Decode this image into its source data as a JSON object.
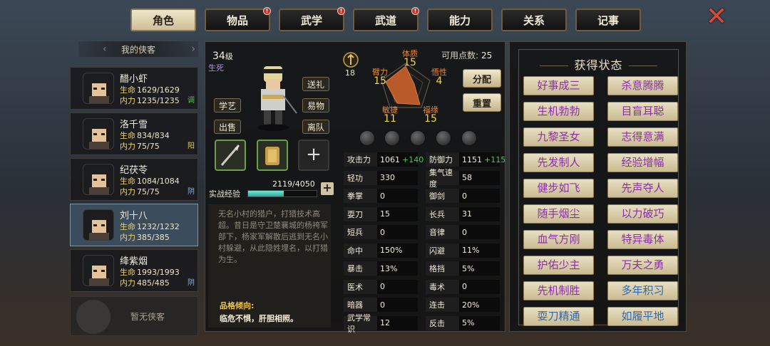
{
  "tabs": [
    {
      "label": "角色",
      "active": true,
      "badge": false
    },
    {
      "label": "物品",
      "active": false,
      "badge": true
    },
    {
      "label": "武学",
      "active": false,
      "badge": true
    },
    {
      "label": "武道",
      "active": false,
      "badge": true
    },
    {
      "label": "能力",
      "active": false,
      "badge": false
    },
    {
      "label": "关系",
      "active": false,
      "badge": false
    },
    {
      "label": "记事",
      "active": false,
      "badge": false
    }
  ],
  "close_glyph": "✕",
  "list": {
    "title": "我的侠客",
    "labels": {
      "hp": "生命",
      "mp": "内力"
    },
    "heroes": [
      {
        "name": "醋小虾",
        "hp": "1629/1629",
        "mp": "1235/1235",
        "tag": "调",
        "tag_color": "#58c35b",
        "active": false
      },
      {
        "name": "洛千雪",
        "hp": "834/834",
        "mp": "75/75",
        "tag": "阳",
        "tag_color": "#f1d04a",
        "active": false
      },
      {
        "name": "纪茯苓",
        "hp": "1084/1084",
        "mp": "75/75",
        "tag": "阴",
        "tag_color": "#8fb0d6",
        "active": false
      },
      {
        "name": "刘十八",
        "hp": "1232/1232",
        "mp": "385/385",
        "tag": "",
        "tag_color": "#ffffff",
        "active": true
      },
      {
        "name": "绛紫烟",
        "hp": "1993/1993",
        "mp": "485/485",
        "tag": "阴",
        "tag_color": "#8fb0d6",
        "active": false
      }
    ],
    "empty_label": "暂无侠客"
  },
  "character": {
    "level": "34",
    "level_suffix": "级",
    "state": "生死",
    "buttons": {
      "learn": "学艺",
      "sell": "出售",
      "gift": "送礼",
      "trade": "易物",
      "leave": "离队"
    },
    "exp_label": "实战经验",
    "exp_text": "2119/4050",
    "exp_progress": 0.523,
    "bio": "无名小村的猎户，打猎技术高超。昔日是守卫楚襄城的杨袴军部下，杨家军解散后逃到无名小村躲避，从此隐姓埋名，以打猎为生。",
    "trait_label": "品格倾向:",
    "trait": "临危不惧，肝胆相照。",
    "medal_count": "18"
  },
  "attributes": {
    "points_label": "可用点数:",
    "points": "25",
    "allocate": "分配",
    "reset": "重置",
    "items": [
      {
        "name": "体质",
        "value": "15"
      },
      {
        "name": "悟性",
        "value": "4"
      },
      {
        "name": "福缘",
        "value": "15"
      },
      {
        "name": "敏捷",
        "value": "11"
      },
      {
        "name": "臂力",
        "value": "15"
      }
    ]
  },
  "stats": [
    {
      "k": "攻击力",
      "v": "1061",
      "bonus": "+140"
    },
    {
      "k": "防御力",
      "v": "1151",
      "bonus": "+115"
    },
    {
      "k": "轻功",
      "v": "330",
      "bonus": ""
    },
    {
      "k": "集气速度",
      "v": "58",
      "bonus": ""
    },
    {
      "k": "拳掌",
      "v": "0",
      "bonus": ""
    },
    {
      "k": "御剑",
      "v": "0",
      "bonus": ""
    },
    {
      "k": "耍刀",
      "v": "15",
      "bonus": ""
    },
    {
      "k": "长兵",
      "v": "31",
      "bonus": ""
    },
    {
      "k": "短兵",
      "v": "0",
      "bonus": ""
    },
    {
      "k": "音律",
      "v": "0",
      "bonus": ""
    },
    {
      "k": "命中",
      "v": "150%",
      "bonus": ""
    },
    {
      "k": "闪避",
      "v": "11%",
      "bonus": ""
    },
    {
      "k": "暴击",
      "v": "13%",
      "bonus": ""
    },
    {
      "k": "格挡",
      "v": "5%",
      "bonus": ""
    },
    {
      "k": "医术",
      "v": "0",
      "bonus": ""
    },
    {
      "k": "毒术",
      "v": "0",
      "bonus": ""
    },
    {
      "k": "暗器",
      "v": "0",
      "bonus": ""
    },
    {
      "k": "连击",
      "v": "20%",
      "bonus": ""
    },
    {
      "k": "武学常识",
      "v": "12",
      "bonus": ""
    },
    {
      "k": "反击",
      "v": "5%",
      "bonus": ""
    }
  ],
  "status_panel": {
    "title": "获得状态",
    "items": [
      {
        "label": "好事成三",
        "color": "purple"
      },
      {
        "label": "杀意腾腾",
        "color": "purple"
      },
      {
        "label": "生机勃勃",
        "color": "purple"
      },
      {
        "label": "目盲耳聪",
        "color": "purple"
      },
      {
        "label": "九黎圣女",
        "color": "purple"
      },
      {
        "label": "志得意满",
        "color": "purple"
      },
      {
        "label": "先发制人",
        "color": "purple"
      },
      {
        "label": "经验增幅",
        "color": "purple"
      },
      {
        "label": "健步如飞",
        "color": "purple"
      },
      {
        "label": "先声夺人",
        "color": "purple"
      },
      {
        "label": "随手烟尘",
        "color": "purple"
      },
      {
        "label": "以力破巧",
        "color": "purple"
      },
      {
        "label": "血气方刚",
        "color": "purple"
      },
      {
        "label": "特异毒体",
        "color": "purple"
      },
      {
        "label": "护佑少主",
        "color": "purple"
      },
      {
        "label": "万夫之勇",
        "color": "purple"
      },
      {
        "label": "先机制胜",
        "color": "purple"
      },
      {
        "label": "多年积习",
        "color": "blue"
      },
      {
        "label": "耍刀精通",
        "color": "blue"
      },
      {
        "label": "如履平地",
        "color": "blue"
      }
    ]
  }
}
